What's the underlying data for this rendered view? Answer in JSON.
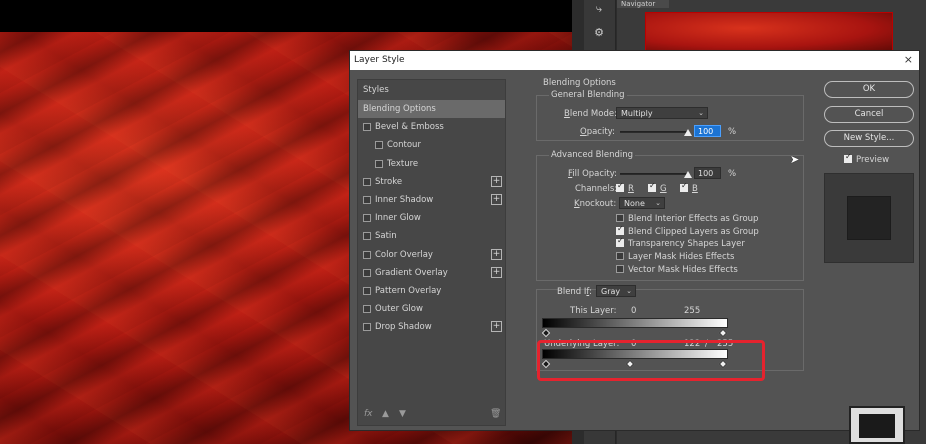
{
  "navigator": {
    "tab_label": "Navigator"
  },
  "dialog": {
    "title": "Layer Style",
    "close_symbol": "×"
  },
  "styles_list": {
    "header": "Styles",
    "items": [
      {
        "label": "Blending Options",
        "checkbox": false,
        "plus": false,
        "selected": true
      },
      {
        "label": "Bevel & Emboss",
        "checkbox": true,
        "checked": false,
        "plus": false
      },
      {
        "label": "Contour",
        "checkbox": true,
        "checked": false,
        "plus": false,
        "indent": true
      },
      {
        "label": "Texture",
        "checkbox": true,
        "checked": false,
        "plus": false,
        "indent": true
      },
      {
        "label": "Stroke",
        "checkbox": true,
        "checked": false,
        "plus": true
      },
      {
        "label": "Inner Shadow",
        "checkbox": true,
        "checked": false,
        "plus": true
      },
      {
        "label": "Inner Glow",
        "checkbox": true,
        "checked": false,
        "plus": false
      },
      {
        "label": "Satin",
        "checkbox": true,
        "checked": false,
        "plus": false
      },
      {
        "label": "Color Overlay",
        "checkbox": true,
        "checked": false,
        "plus": true
      },
      {
        "label": "Gradient Overlay",
        "checkbox": true,
        "checked": false,
        "plus": true
      },
      {
        "label": "Pattern Overlay",
        "checkbox": true,
        "checked": false,
        "plus": false
      },
      {
        "label": "Outer Glow",
        "checkbox": true,
        "checked": false,
        "plus": false
      },
      {
        "label": "Drop Shadow",
        "checkbox": true,
        "checked": false,
        "plus": true
      }
    ],
    "footer": {
      "fx": "fx",
      "up": "▲",
      "down": "▼",
      "trash": "🗑"
    }
  },
  "blending_options": {
    "title": "Blending Options",
    "general": {
      "title": "General Blending",
      "blend_mode_label": "Blend Mode:",
      "blend_mode_value": "Multiply",
      "opacity_label": "Opacity:",
      "opacity_value": "100",
      "opacity_unit": "%",
      "opacity_fraction": 1.0
    },
    "advanced": {
      "title": "Advanced Blending",
      "fill_opacity_label": "Fill Opacity:",
      "fill_opacity_value": "100",
      "fill_opacity_unit": "%",
      "fill_opacity_fraction": 1.0,
      "channels_label": "Channels:",
      "channels": [
        {
          "label": "R",
          "checked": true
        },
        {
          "label": "G",
          "checked": true
        },
        {
          "label": "B",
          "checked": true
        }
      ],
      "knockout_label": "Knockout:",
      "knockout_value": "None",
      "options": [
        {
          "label": "Blend Interior Effects as Group",
          "checked": false
        },
        {
          "label": "Blend Clipped Layers as Group",
          "checked": true
        },
        {
          "label": "Transparency Shapes Layer",
          "checked": true
        },
        {
          "label": "Layer Mask Hides Effects",
          "checked": false
        },
        {
          "label": "Vector Mask Hides Effects",
          "checked": false
        }
      ]
    },
    "blend_if": {
      "label": "Blend If:",
      "value": "Gray",
      "this_layer_label": "This Layer:",
      "this_layer_min": "0",
      "this_layer_max": "255",
      "underlying_label": "Underlying Layer:",
      "underlying_min": "0",
      "underlying_split_low": "122",
      "underlying_separator": "/",
      "underlying_max": "255"
    }
  },
  "buttons": {
    "ok": "OK",
    "cancel": "Cancel",
    "new_style": "New Style...",
    "preview_label": "Preview",
    "preview_checked": true
  }
}
